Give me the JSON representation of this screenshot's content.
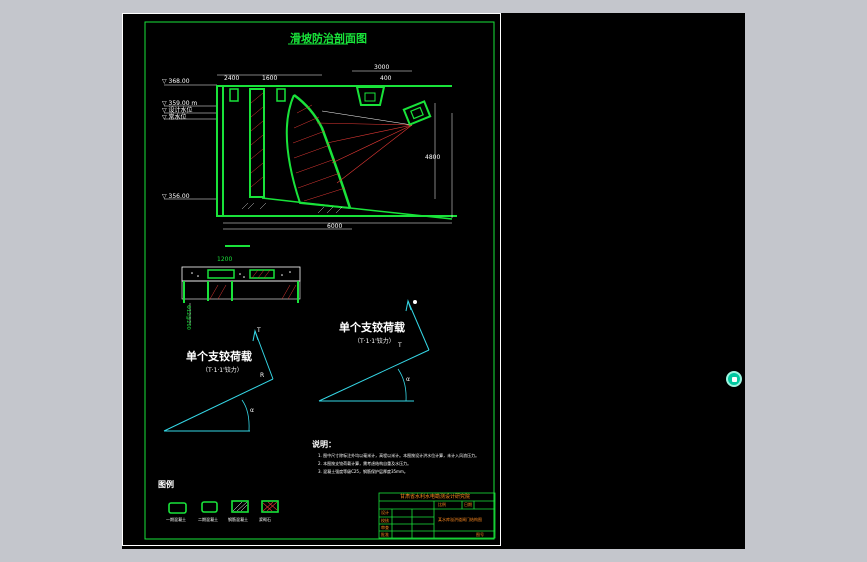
{
  "drawing": {
    "title": "滑坡防治剖面图",
    "labels": {
      "elev_top": "▽ 368.00",
      "elev_water_1": "▽ 359.00 m",
      "elev_water_2": "▽ 设计水位",
      "elev_water_3": "▽ 常水位",
      "elev_bottom": "▽ 356.00",
      "dim_top_1": "2400",
      "dim_top_2": "1600",
      "dim_top_3": "3000",
      "dim_right": "4800",
      "dim_bottom": "6000",
      "dim_small": "400",
      "section_dim": "1200",
      "rebar_note": "Φ12@200"
    },
    "vector_diagram_1": {
      "title": "单个支铰荷载",
      "subtitle": "（T·1·1'铰力）",
      "angle_label": "α",
      "force_label": "T",
      "r_label": "R"
    },
    "vector_diagram_2": {
      "title": "单个支铰荷载",
      "subtitle": "（T·1·1'铰力）",
      "angle_label": "α",
      "force_label": "T"
    },
    "notes": {
      "heading": "说明：",
      "items": [
        "1. 图中尺寸除标注外均以毫米计，高程以米计。本图按设计洪水位计算，未计入风浪压力。",
        "2. 本图按支铰荷载计算，需考虑结构自重及水压力。",
        "3. 混凝土强度等级C25，钢筋保护层厚度35mm。"
      ]
    },
    "legend": {
      "heading": "图例",
      "items": [
        {
          "label": "一期混凝土"
        },
        {
          "label": "二期混凝土"
        },
        {
          "label": "钢筋混凝土"
        },
        {
          "label": "浆砌石"
        }
      ]
    },
    "title_block": {
      "org": "甘肃省水利水电勘测设计研究院",
      "drawing_name": "某水库溢洪道闸门结构图",
      "rows": [
        "设计",
        "校核",
        "审查",
        "批准"
      ],
      "scale": "比例",
      "date": "日期",
      "number": "图号"
    }
  },
  "colors": {
    "background": "#000000",
    "outer": "#c4c6cc",
    "line_green": "#19e33a",
    "line_white": "#ffffff",
    "line_red": "#e53935",
    "line_cyan": "#35d7e6",
    "title_block_text": "#ff8a1f",
    "nav_cube": "#00c8a0"
  },
  "icons": {
    "nav": "navigation-wheel-icon"
  }
}
